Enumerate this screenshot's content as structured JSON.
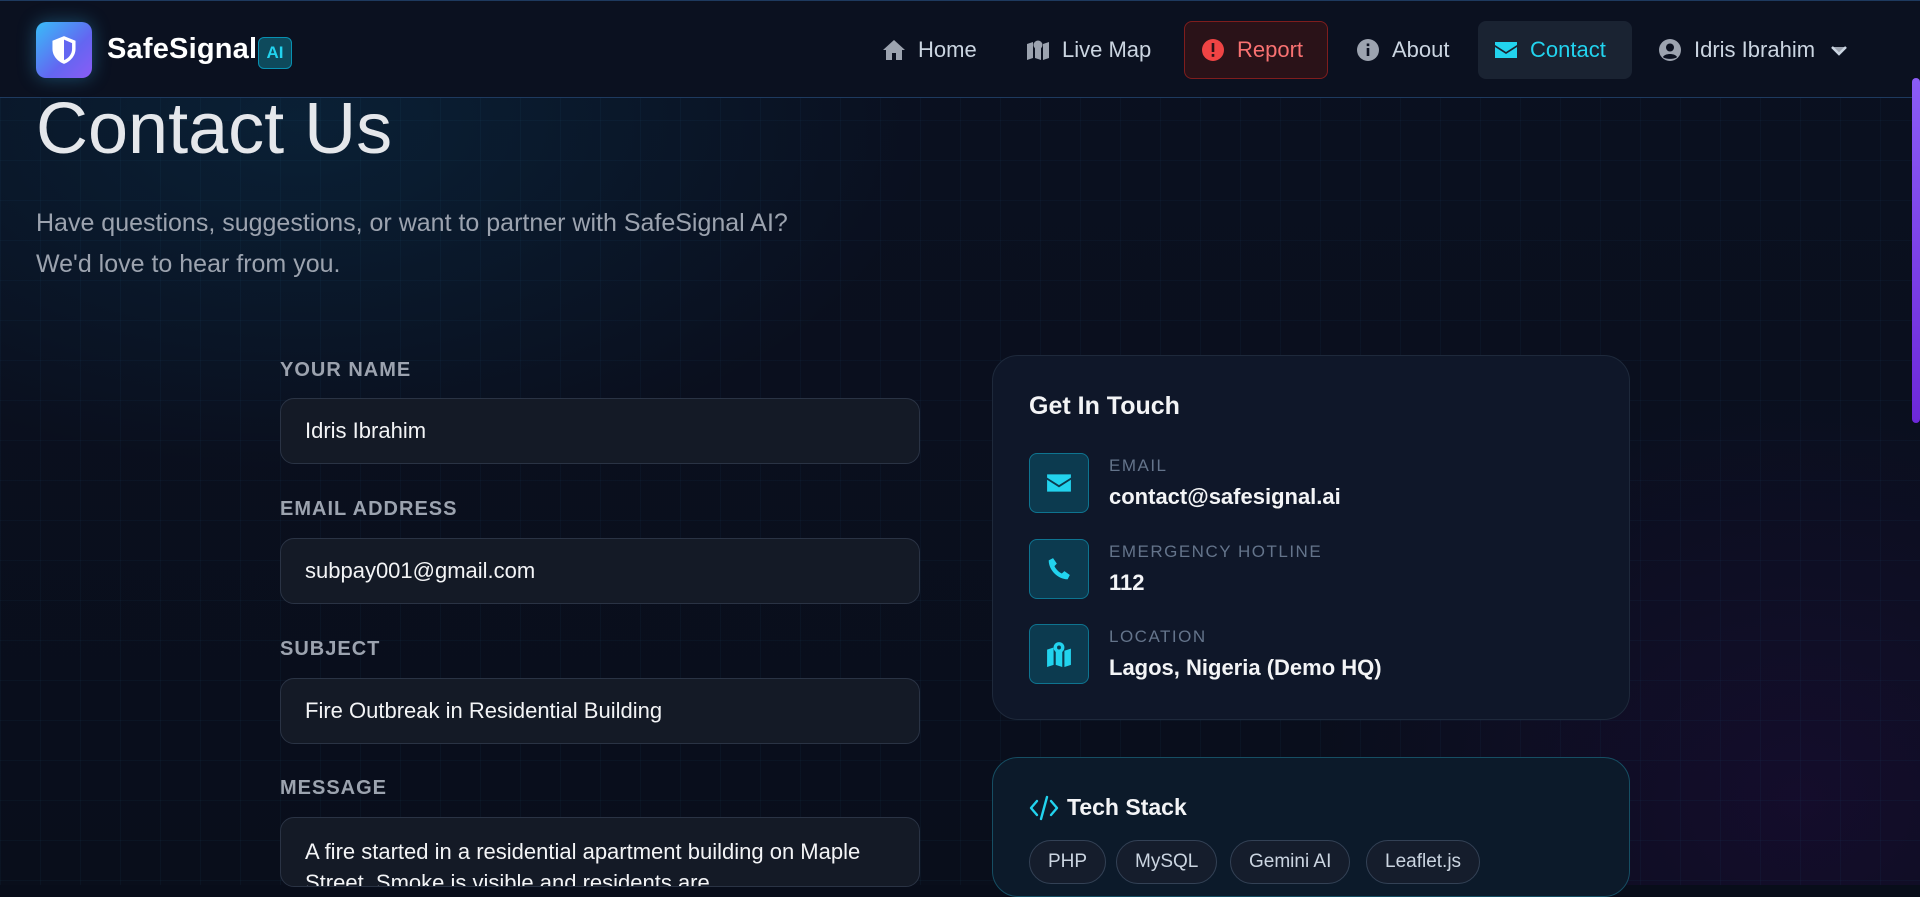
{
  "brand": {
    "name": "SafeSignal",
    "badge": "AI"
  },
  "nav": {
    "home": "Home",
    "live_map": "Live Map",
    "report": "Report",
    "about": "About",
    "contact": "Contact",
    "user": "Idris Ibrahim"
  },
  "hero": {
    "title": "Contact Us",
    "subtitle_line1": "Have questions, suggestions, or want to partner with SafeSignal AI?",
    "subtitle_line2": "We'd love to hear from you."
  },
  "form": {
    "name_label": "YOUR NAME",
    "name_value": "Idris Ibrahim",
    "email_label": "EMAIL ADDRESS",
    "email_value": "subpay001@gmail.com",
    "subject_label": "SUBJECT",
    "subject_value": "Fire Outbreak in Residential Building",
    "message_label": "MESSAGE",
    "message_value": "A fire started in a residential apartment building on Maple Street. Smoke is visible and residents are"
  },
  "contact_card": {
    "title": "Get In Touch",
    "items": [
      {
        "label": "EMAIL",
        "value": "contact@safesignal.ai",
        "icon": "envelope-icon"
      },
      {
        "label": "EMERGENCY HOTLINE",
        "value": "112",
        "icon": "phone-icon"
      },
      {
        "label": "LOCATION",
        "value": "Lagos, Nigeria (Demo HQ)",
        "icon": "map-location-icon"
      }
    ]
  },
  "tech_card": {
    "title": "Tech Stack",
    "chips": [
      "PHP",
      "MySQL",
      "Gemini AI",
      "Leaflet.js"
    ]
  },
  "colors": {
    "accent": "#22d3ee",
    "report": "#f87171",
    "background": "#080d1a",
    "brand_gradient_start": "#38bdf8",
    "brand_gradient_end": "#8b5cf6"
  }
}
